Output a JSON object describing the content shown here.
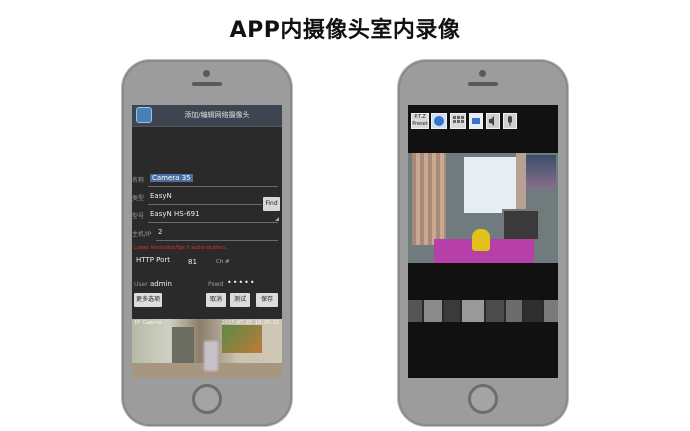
{
  "title": "APP内摄像头室内录像",
  "left_screen": {
    "header": "添加/编辑网络摄像头",
    "name_label": "名称",
    "name_value": "Camera 35",
    "type_label": "类型",
    "type_value": "EasyN",
    "model_label": "型号",
    "model_value": "EasyN HS-691",
    "host_label": "主机/IP",
    "host_value": "2",
    "find_label": "Find",
    "warning": "Lower resolution/fps if audio stutters.",
    "http_port_label": "HTTP Port",
    "http_port_value": "81",
    "ch_label": "Ch.#",
    "user_label": "User",
    "user_value": "admin",
    "pwd_label": "Pswd",
    "pwd_value": "•••••",
    "btn_more": "更多选项",
    "btn_cancel": "取消",
    "btn_test": "测试",
    "btn_save": "保存",
    "osd_cam": "IP Camera",
    "osd_time": "2017-07-25 10:26:21"
  },
  "right_screen": {
    "ptz_label": "P.T.Z\nPreset",
    "icons": [
      "ptz-icon",
      "record-icon",
      "grid-icon",
      "hd-icon",
      "volume-icon",
      "mic-icon"
    ]
  }
}
